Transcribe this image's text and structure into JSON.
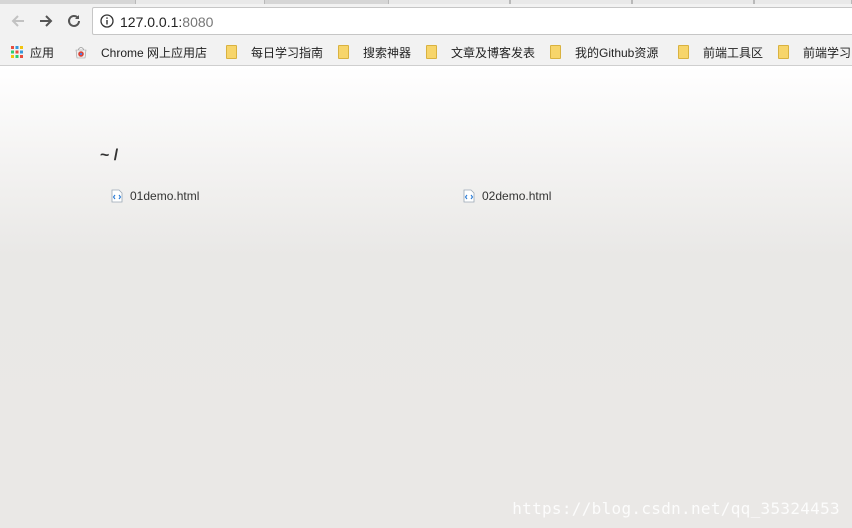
{
  "browser": {
    "url_host": "127.0.0.1:",
    "url_port": "8080"
  },
  "bookmarks": {
    "items": [
      {
        "label": "应用",
        "icon": "apps-grid-icon"
      },
      {
        "label": "Chrome 网上应用店",
        "icon": "chrome-webstore-icon"
      },
      {
        "label": "每日学习指南",
        "icon": "folder-icon"
      },
      {
        "label": "搜索神器",
        "icon": "folder-icon"
      },
      {
        "label": "文章及博客发表",
        "icon": "folder-icon"
      },
      {
        "label": "我的Github资源",
        "icon": "folder-icon"
      },
      {
        "label": "前端工具区",
        "icon": "folder-icon"
      },
      {
        "label": "前端学习",
        "icon": "folder-icon"
      }
    ]
  },
  "page": {
    "path": "~ /",
    "files": [
      {
        "name": "01demo.html",
        "icon": "html-file-icon"
      },
      {
        "name": "02demo.html",
        "icon": "html-file-icon"
      }
    ]
  },
  "watermark": "https://blog.csdn.net/qq_35324453",
  "colors": {
    "page_text": "#333333",
    "folder": "#f7d56b",
    "file_icon": "#2a7bd6"
  }
}
